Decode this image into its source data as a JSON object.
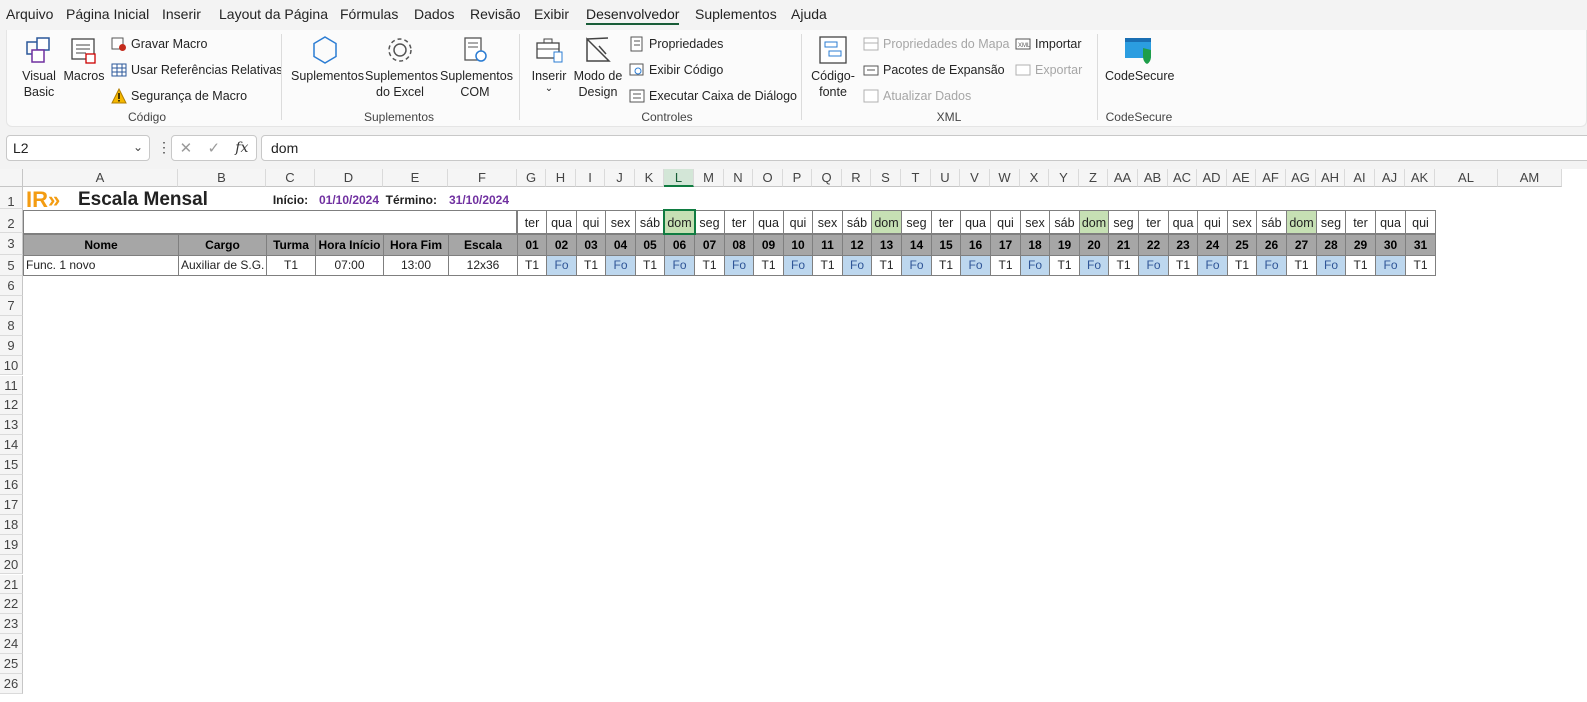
{
  "menu": [
    "Arquivo",
    "Página Inicial",
    "Inserir",
    "Layout da Página",
    "Fórmulas",
    "Dados",
    "Revisão",
    "Exibir",
    "Desenvolvedor",
    "Suplementos",
    "Ajuda"
  ],
  "menu_active": "Desenvolvedor",
  "ribbon": {
    "codigo": {
      "visual_basic_1": "Visual",
      "visual_basic_2": "Basic",
      "macros": "Macros",
      "gravar": "Gravar Macro",
      "relativas": "Usar Referências Relativas",
      "seguranca": "Segurança de Macro",
      "label": "Código"
    },
    "suplementos": {
      "sup_1": "Suplementos",
      "excel_1": "Suplementos",
      "excel_2": "do Excel",
      "com_1": "Suplementos",
      "com_2": "COM",
      "label": "Suplementos"
    },
    "controles": {
      "inserir": "Inserir",
      "modo_1": "Modo de",
      "modo_2": "Design",
      "propriedades": "Propriedades",
      "exibir_codigo": "Exibir Código",
      "executar": "Executar Caixa de Diálogo",
      "label": "Controles"
    },
    "xml": {
      "codigo_1": "Código-",
      "codigo_2": "fonte",
      "prop_mapa": "Propriedades do Mapa",
      "pacotes": "Pacotes de Expansão",
      "atualizar": "Atualizar Dados",
      "importar": "Importar",
      "exportar": "Exportar",
      "label": "XML"
    },
    "codesecure": {
      "button": "CodeSecure",
      "label": "CodeSecure"
    }
  },
  "formula": {
    "namebox": "L2",
    "value": "dom"
  },
  "columns": [
    "A",
    "B",
    "C",
    "D",
    "E",
    "F",
    "G",
    "H",
    "I",
    "J",
    "K",
    "L",
    "M",
    "N",
    "O",
    "P",
    "Q",
    "R",
    "S",
    "T",
    "U",
    "V",
    "W",
    "X",
    "Y",
    "Z",
    "AA",
    "AB",
    "AC",
    "AD",
    "AE",
    "AF",
    "AG",
    "AH",
    "AI",
    "AJ",
    "AK",
    "AL",
    "AM"
  ],
  "selected_column": "L",
  "rows": [
    "1",
    "2",
    "3",
    "5",
    "6",
    "7",
    "8",
    "9",
    "10",
    "11",
    "12",
    "13",
    "14",
    "15",
    "16",
    "17",
    "18",
    "19",
    "20",
    "21",
    "22",
    "23",
    "24",
    "25",
    "26"
  ],
  "sheet": {
    "title": "Escala Mensal",
    "logo": "IR»",
    "inicio_label": "Início:",
    "inicio": "01/10/2024",
    "termino_label": "Término:",
    "termino": "31/10/2024",
    "headers": [
      "Nome",
      "Cargo",
      "Turma",
      "Hora Início",
      "Hora Fim",
      "Escala"
    ],
    "weekdays": [
      "ter",
      "qua",
      "qui",
      "sex",
      "sáb",
      "dom",
      "seg",
      "ter",
      "qua",
      "qui",
      "sex",
      "sáb",
      "dom",
      "seg",
      "ter",
      "qua",
      "qui",
      "sex",
      "sáb",
      "dom",
      "seg",
      "ter",
      "qua",
      "qui",
      "sex",
      "sáb",
      "dom",
      "seg",
      "ter",
      "qua",
      "qui"
    ],
    "days": [
      "01",
      "02",
      "03",
      "04",
      "05",
      "06",
      "07",
      "08",
      "09",
      "10",
      "11",
      "12",
      "13",
      "14",
      "15",
      "16",
      "17",
      "18",
      "19",
      "20",
      "21",
      "22",
      "23",
      "24",
      "25",
      "26",
      "27",
      "28",
      "29",
      "30",
      "31"
    ],
    "employee": {
      "nome": "Func. 1 novo",
      "cargo": "Auxiliar de S.G.",
      "turma": "T1",
      "inicio": "07:00",
      "fim": "13:00",
      "escala": "12x36"
    },
    "schedule": [
      "T1",
      "Fo",
      "T1",
      "Fo",
      "T1",
      "Fo",
      "T1",
      "Fo",
      "T1",
      "Fo",
      "T1",
      "Fo",
      "T1",
      "Fo",
      "T1",
      "Fo",
      "T1",
      "Fo",
      "T1",
      "Fo",
      "T1",
      "Fo",
      "T1",
      "Fo",
      "T1",
      "Fo",
      "T1",
      "Fo",
      "T1",
      "Fo",
      "T1"
    ]
  },
  "colors": {
    "accent": "#107c41",
    "title_dates": "#7030a0",
    "header_fill": "#a6a6a6",
    "folga_fill": "#bdd7ee",
    "dom_fill": "#c6e0b4"
  }
}
